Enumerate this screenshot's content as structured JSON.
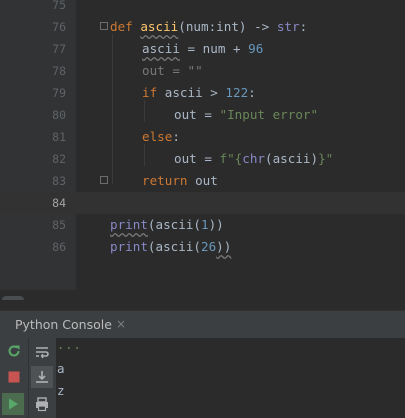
{
  "editor": {
    "line_numbers": [
      "75",
      "76",
      "77",
      "78",
      "79",
      "80",
      "81",
      "82",
      "83",
      "84",
      "85",
      "86"
    ],
    "code": {
      "l76": {
        "def": "def ",
        "name": "ascii",
        "params": "(num:int) -> ",
        "ret": "str",
        "colon": ":"
      },
      "l77": {
        "var": "ascii",
        "op": " = num + ",
        "num": "96"
      },
      "l78": {
        "text": "out = \"\""
      },
      "l79": {
        "kw": "if",
        "cond": " ascii > ",
        "num": "122",
        "colon": ":"
      },
      "l80": {
        "lhs": "out = ",
        "str": "\"Input error\""
      },
      "l81": {
        "kw": "else",
        "colon": ":"
      },
      "l82": {
        "lhs": "out = ",
        "str1": "f\"{",
        "fn": "chr",
        "args": "(ascii)",
        "str2": "}\""
      },
      "l83": {
        "kw": "return",
        "rest": " out"
      },
      "l85": {
        "fn": "print",
        "a": "(ascii(",
        "num": "1",
        "b": "))"
      },
      "l86": {
        "fn": "print",
        "a": "(ascii(",
        "num": "26",
        "b": "))"
      }
    }
  },
  "console": {
    "title": "Python Console",
    "close": "×",
    "prompt_dots": "...",
    "output": [
      "a",
      "z"
    ]
  },
  "icons": {
    "rerun": "rerun-icon",
    "stop": "stop-icon",
    "run": "run-icon",
    "soft_wrap": "soft-wrap-icon",
    "scroll_to_end": "scroll-to-end-icon",
    "print": "print-icon"
  }
}
